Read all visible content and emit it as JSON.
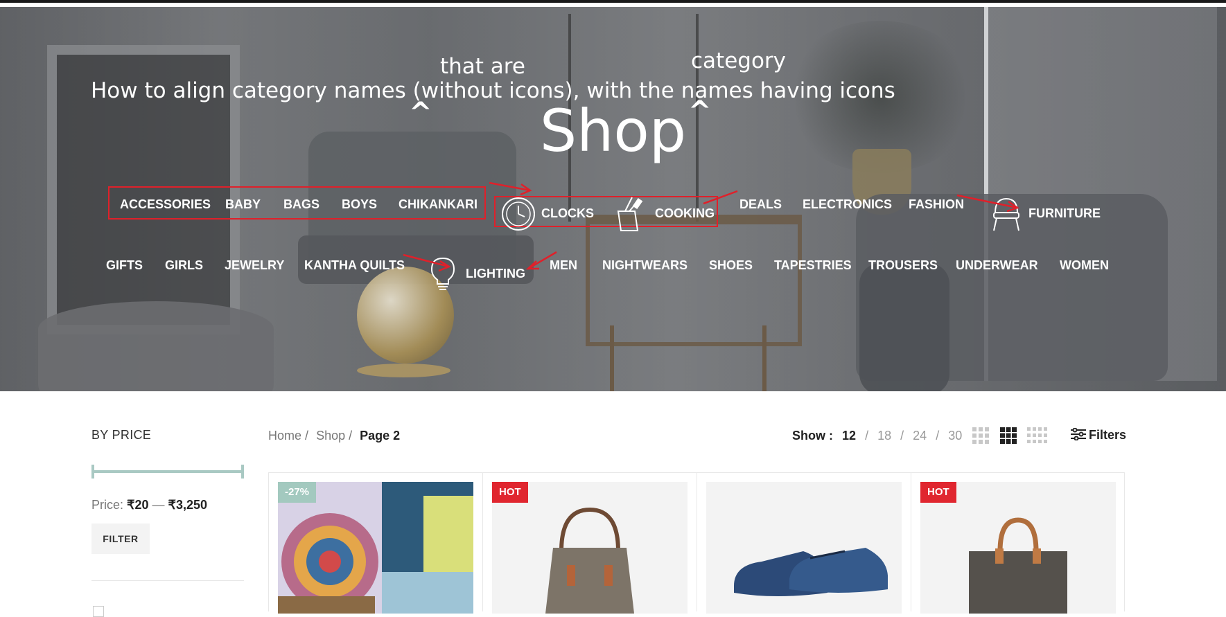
{
  "hero": {
    "title": "Shop",
    "annotation_main": "How to align category names (without icons), with the names having icons",
    "annotation_that_are": "that are",
    "annotation_category": "category",
    "categories_row1": [
      {
        "label": "ACCESSORIES",
        "icon": null
      },
      {
        "label": "BABY",
        "icon": null
      },
      {
        "label": "BAGS",
        "icon": null
      },
      {
        "label": "BOYS",
        "icon": null
      },
      {
        "label": "CHIKANKARI",
        "icon": null
      },
      {
        "label": "CLOCKS",
        "icon": "clock-icon"
      },
      {
        "label": "COOKING",
        "icon": "knife-block-icon"
      },
      {
        "label": "DEALS",
        "icon": null
      },
      {
        "label": "ELECTRONICS",
        "icon": null
      },
      {
        "label": "FASHION",
        "icon": null
      },
      {
        "label": "FURNITURE",
        "icon": "chair-icon"
      }
    ],
    "categories_row2": [
      {
        "label": "GIFTS",
        "icon": null
      },
      {
        "label": "GIRLS",
        "icon": null
      },
      {
        "label": "JEWELRY",
        "icon": null
      },
      {
        "label": "KANTHA QUILTS",
        "icon": null
      },
      {
        "label": "LIGHTING",
        "icon": "lightbulb-icon"
      },
      {
        "label": "MEN",
        "icon": null
      },
      {
        "label": "NIGHTWEARS",
        "icon": null
      },
      {
        "label": "SHOES",
        "icon": null
      },
      {
        "label": "TAPESTRIES",
        "icon": null
      },
      {
        "label": "TROUSERS",
        "icon": null
      },
      {
        "label": "UNDERWEAR",
        "icon": null
      },
      {
        "label": "WOMEN",
        "icon": null
      }
    ],
    "annotation_color": "#e0202a"
  },
  "sidebar": {
    "title": "BY PRICE",
    "price_prefix": "Price:",
    "price_min": "₹20",
    "price_sep": "—",
    "price_max": "₹3,250",
    "filter_button": "FILTER",
    "slider_color": "#a9c9c3"
  },
  "breadcrumb": {
    "home": "Home",
    "sep": "/",
    "shop": "Shop",
    "current": "Page 2"
  },
  "toolbar": {
    "show_label": "Show :",
    "options": [
      "12",
      "18",
      "24",
      "30"
    ],
    "active_option": "12",
    "filters_label": "Filters"
  },
  "products": [
    {
      "badge": "-27%",
      "badge_type": "discount",
      "image": "tapestry"
    },
    {
      "badge": "HOT",
      "badge_type": "hot",
      "image": "tote-bag"
    },
    {
      "badge": null,
      "badge_type": null,
      "image": "blue-shoes"
    },
    {
      "badge": "HOT",
      "badge_type": "hot",
      "image": "grey-bag"
    }
  ],
  "colors": {
    "hot": "#e0262f",
    "discount": "#a3c9bf",
    "annotation_red": "#e0202a"
  }
}
